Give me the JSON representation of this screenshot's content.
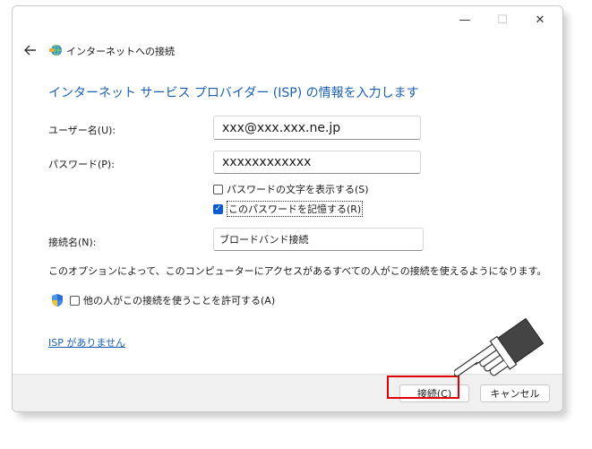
{
  "window": {
    "caption_buttons": {
      "minimize": "—",
      "maximize": "☐",
      "close": "✕"
    },
    "icons": {
      "back": "back-arrow-icon",
      "wizard": "network-globe-icon",
      "shield": "uac-shield-icon"
    }
  },
  "header": {
    "title": "インターネットへの接続"
  },
  "main": {
    "heading": "インターネット サービス プロバイダー (ISP) の情報を入力します",
    "username": {
      "label": "ユーザー名(U):",
      "value": "xxx@xxx.xxx.ne.jp"
    },
    "password": {
      "label": "パスワード(P):",
      "value": "xxxxxxxxxxxx"
    },
    "show_password": {
      "label": "パスワードの文字を表示する(S)",
      "checked": false
    },
    "remember_password": {
      "label": "このパスワードを記憶する(R)",
      "checked": true
    },
    "connection_name": {
      "label": "接続名(N):",
      "value": "ブロードバンド接続"
    },
    "info_text": "このオプションによって、このコンピューターにアクセスがあるすべての人がこの接続を使えるようになります。",
    "allow_others": {
      "label": "他の人がこの接続を使うことを許可する(A)",
      "checked": false
    },
    "no_isp_link": "ISP がありません"
  },
  "footer": {
    "connect_label": "接続(C)",
    "cancel_label": "キャンセル"
  },
  "colors": {
    "accent": "#1a5fb4",
    "highlight": "#e00000",
    "check": "#0a5bd0"
  }
}
